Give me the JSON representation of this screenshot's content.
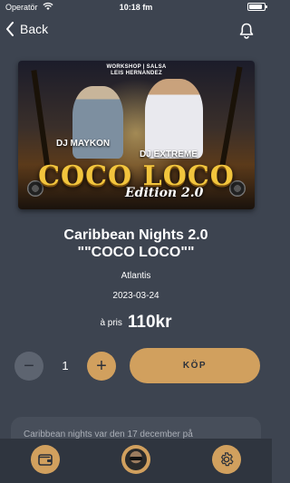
{
  "status_bar": {
    "carrier": "Operatör",
    "time": "10:18 fm",
    "battery_level": 0.9
  },
  "nav": {
    "back_label": "Back",
    "back_icon": "chevron-left-icon",
    "bell_icon": "bell-icon"
  },
  "poster": {
    "top_text": "WORKSHOP | SALSA",
    "top_text2": "LEIS HERNANDEZ",
    "dj_left": "DJ MAYKON",
    "dj_right": "DJ EXTREME",
    "headline": "COCO LOCO",
    "edition": "Edition 2.0"
  },
  "event": {
    "title_line1": "Caribbean Nights 2.0",
    "title_line2": "\"\"COCO LOCO\"\"",
    "venue": "Atlantis",
    "date": "2023-03-24",
    "price_label": "à pris",
    "price_value": "110kr"
  },
  "purchase": {
    "quantity": "1",
    "minus_symbol": "−",
    "plus_symbol": "+",
    "buy_label": "KÖP"
  },
  "description": {
    "text": "Caribbean nights var den 17 december på"
  },
  "tabbar": {
    "left_icon": "wallet-icon",
    "center_icon": "avatar",
    "right_icon": "gear-icon"
  },
  "colors": {
    "background": "#3d4450",
    "accent": "#d1a05e",
    "tabbar": "#2f353f"
  }
}
